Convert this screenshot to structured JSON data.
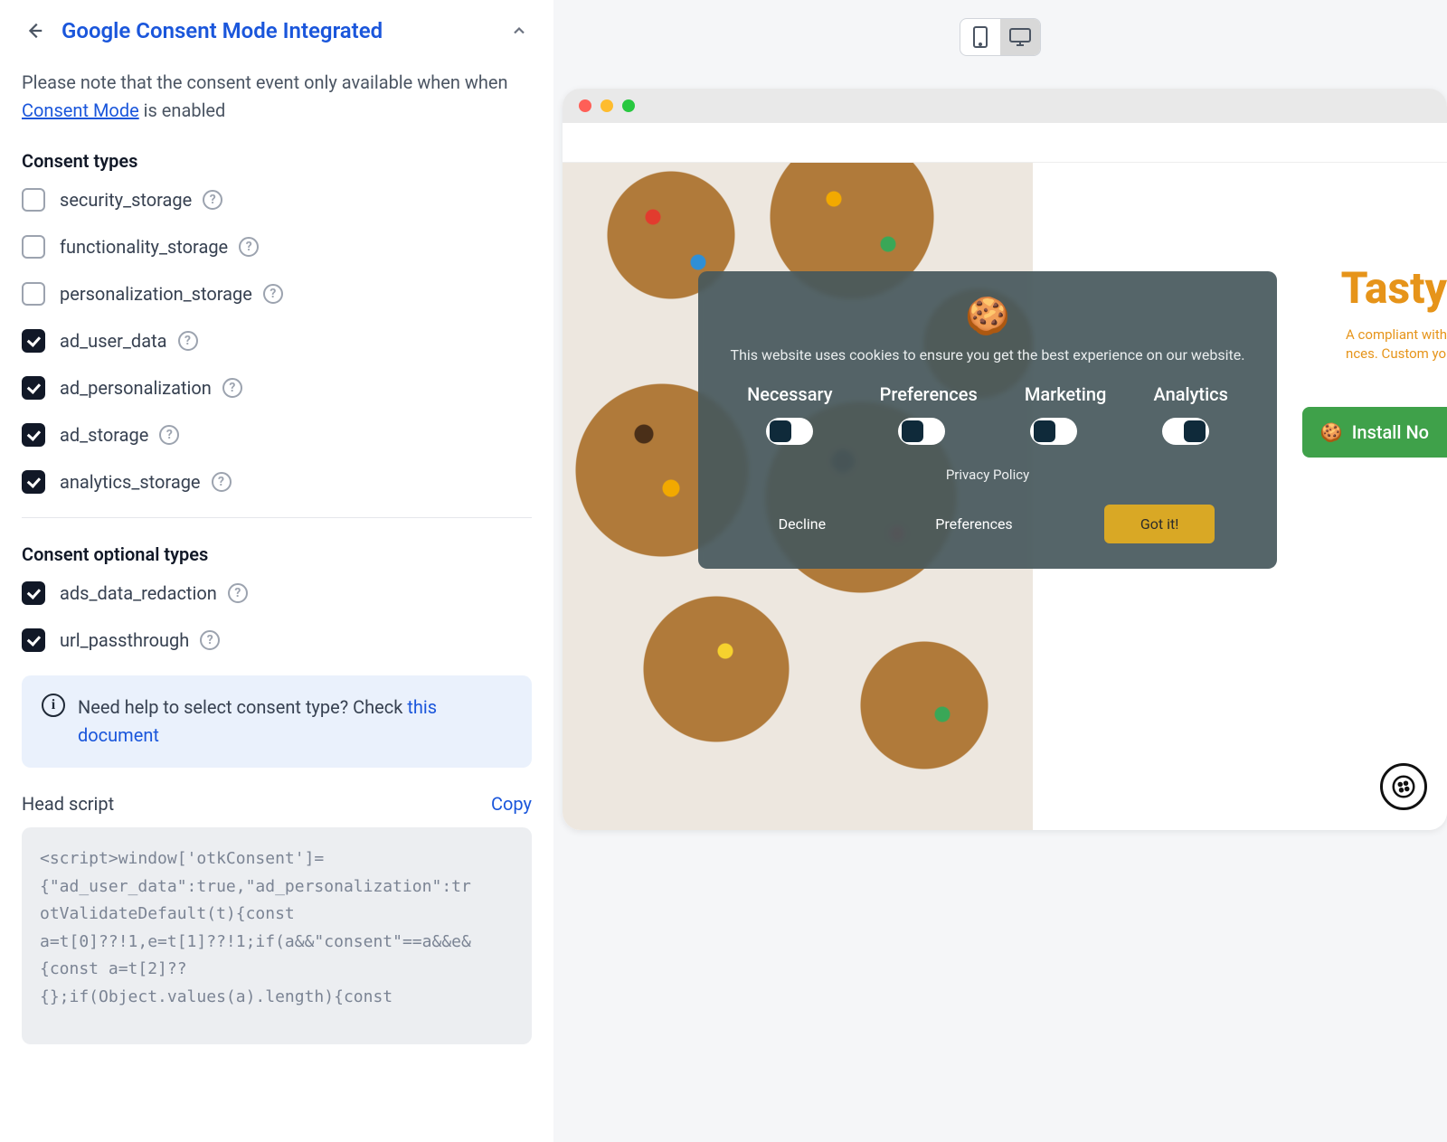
{
  "leftPanel": {
    "title": "Google Consent Mode Integrated",
    "noteBefore": "Please note that the consent event only available when when ",
    "noteLink": "Consent Mode",
    "noteAfter": " is enabled",
    "sectionTypes": "Consent types",
    "types": [
      {
        "label": "security_storage",
        "checked": false
      },
      {
        "label": "functionality_storage",
        "checked": false
      },
      {
        "label": "personalization_storage",
        "checked": false
      },
      {
        "label": "ad_user_data",
        "checked": true
      },
      {
        "label": "ad_personalization",
        "checked": true
      },
      {
        "label": "ad_storage",
        "checked": true
      },
      {
        "label": "analytics_storage",
        "checked": true
      }
    ],
    "sectionOptional": "Consent optional types",
    "optional": [
      {
        "label": "ads_data_redaction",
        "checked": true
      },
      {
        "label": "url_passthrough",
        "checked": true
      }
    ],
    "infoText": "Need help to select consent type? Check ",
    "infoLink": "this document",
    "scriptTitle": "Head script",
    "copy": "Copy",
    "code": "<script>window['otkConsent']=\n{\"ad_user_data\":true,\"ad_personalization\":tr\notValidateDefault(t){const\na=t[0]??!1,e=t[1]??!1;if(a&&\"consent\"==a&&e&\n{const a=t[2]??\n{};if(Object.values(a).length){const"
  },
  "preview": {
    "heroTitle": "Tasty",
    "heroSub1": "A compliant with",
    "heroSub2": "nces. Custom yo",
    "installLabel": "Install No",
    "banner": {
      "text": "This website uses cookies to ensure you get the best experience on our website.",
      "categories": [
        "Necessary",
        "Preferences",
        "Marketing",
        "Analytics"
      ],
      "toggles": [
        "on",
        "on",
        "on",
        "off"
      ],
      "privacy": "Privacy Policy",
      "decline": "Decline",
      "preferences": "Preferences",
      "gotit": "Got it!"
    }
  }
}
